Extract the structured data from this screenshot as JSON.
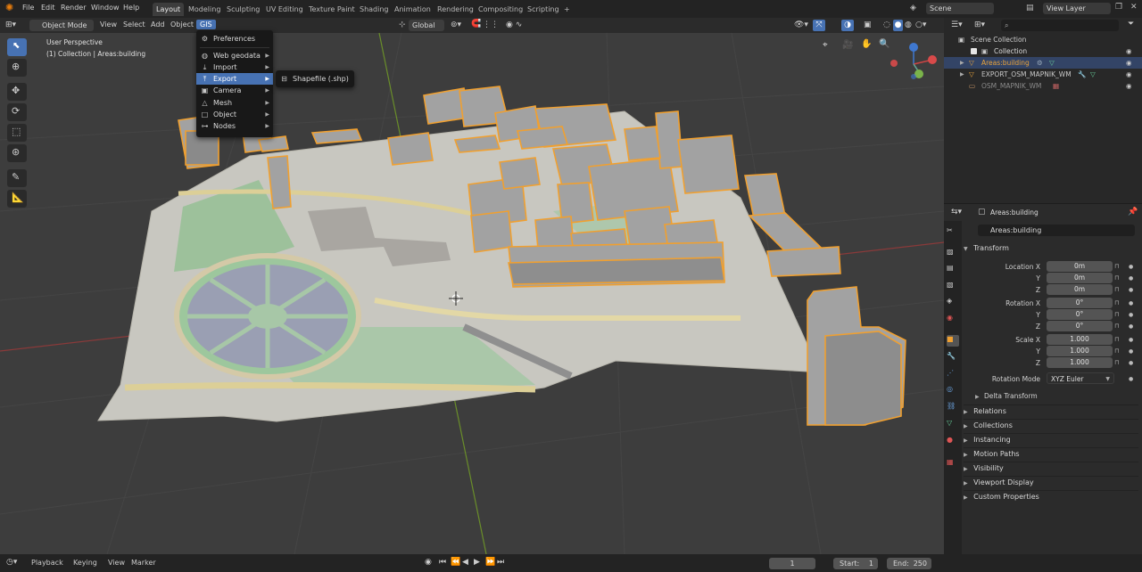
{
  "menubar": {
    "items": [
      "File",
      "Edit",
      "Render",
      "Window",
      "Help"
    ],
    "workspaces": [
      "Layout",
      "Modeling",
      "Sculpting",
      "UV Editing",
      "Texture Paint",
      "Shading",
      "Animation",
      "Rendering",
      "Compositing",
      "Scripting"
    ],
    "active_workspace": "Layout",
    "add_tab": "+",
    "scene": "Scene",
    "view_layer": "View Layer"
  },
  "viewport_header": {
    "mode": "Object Mode",
    "menus": [
      "View",
      "Select",
      "Add",
      "Object",
      "GIS"
    ],
    "active_menu": "GIS",
    "orientation": "Global"
  },
  "viewport": {
    "perspective": "User Perspective",
    "collection_info": "(1) Collection | Areas:building"
  },
  "gis_menu": {
    "items": [
      {
        "label": "Preferences",
        "icon": "gear-icon",
        "submenu": false
      },
      {
        "label": "Web geodata",
        "icon": "globe-icon",
        "submenu": true
      },
      {
        "label": "Import",
        "icon": "import-icon",
        "submenu": true
      },
      {
        "label": "Export",
        "icon": "export-icon",
        "submenu": true,
        "highlighted": true
      },
      {
        "label": "Camera",
        "icon": "camera-icon",
        "submenu": true
      },
      {
        "label": "Mesh",
        "icon": "mesh-icon",
        "submenu": true
      },
      {
        "label": "Object",
        "icon": "object-icon",
        "submenu": true
      },
      {
        "label": "Nodes",
        "icon": "nodes-icon",
        "submenu": true
      }
    ],
    "export_submenu": [
      "Shapefile (.shp)"
    ]
  },
  "outliner": {
    "search_placeholder": "",
    "root": "Scene Collection",
    "collection": "Collection",
    "objects": [
      {
        "name": "Areas:building",
        "color": "#e8a33c"
      },
      {
        "name": "EXPORT_OSM_MAPNIK_WM",
        "color": "#c8c8c8"
      },
      {
        "name": "OSM_MAPNIK_WM",
        "color": "#8a8a8a"
      }
    ]
  },
  "properties": {
    "header_object": "Areas:building",
    "object_name": "Areas:building",
    "transform_title": "Transform",
    "location": {
      "label": "Location X",
      "x": "0m",
      "y": "0m",
      "z": "0m"
    },
    "rotation": {
      "label": "Rotation X",
      "x": "0°",
      "y": "0°",
      "z": "0°"
    },
    "scale": {
      "label": "Scale X",
      "x": "1.000",
      "y": "1.000",
      "z": "1.000"
    },
    "axis_y": "Y",
    "axis_z": "Z",
    "rotation_mode_label": "Rotation Mode",
    "rotation_mode": "XYZ Euler",
    "delta_transform": "Delta Transform",
    "panels": [
      "Relations",
      "Collections",
      "Instancing",
      "Motion Paths",
      "Visibility",
      "Viewport Display",
      "Custom Properties"
    ]
  },
  "timeline": {
    "menus": [
      "Playback",
      "Keying",
      "View",
      "Marker"
    ],
    "current_frame": "1",
    "start_label": "Start:",
    "start": "1",
    "end_label": "End:",
    "end": "250"
  },
  "colors": {
    "accent": "#4772b3",
    "selection": "#f0a030",
    "viewport_bg": "#3d3d3d"
  }
}
